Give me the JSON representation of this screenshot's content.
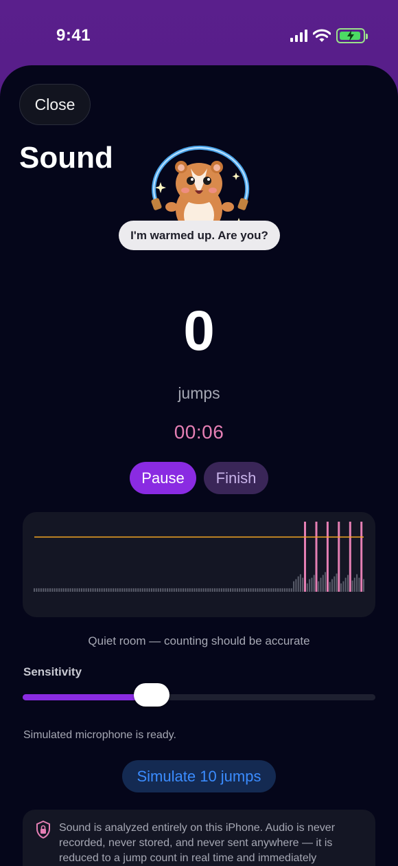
{
  "status_bar": {
    "time": "9:41",
    "icons": [
      "signal-icon",
      "wifi-icon",
      "battery-charging-icon"
    ]
  },
  "header": {
    "close_label": "Close",
    "title": "Sound"
  },
  "mascot": {
    "icon": "hamster-jump-rope-icon",
    "speech": "I'm warmed up. Are you?"
  },
  "counter": {
    "count": "0",
    "unit": "jumps",
    "timer": "00:06"
  },
  "controls": {
    "pause_label": "Pause",
    "finish_label": "Finish"
  },
  "waveform": {
    "threshold_color": "#f5a623",
    "peak_color": "#e57fb4",
    "level_color": "#5a5d6b",
    "levels": [
      0.05,
      0.05,
      0.05,
      0.05,
      0.05,
      0.05,
      0.05,
      0.05,
      0.05,
      0.05,
      0.05,
      0.05,
      0.05,
      0.05,
      0.05,
      0.05,
      0.05,
      0.05,
      0.05,
      0.05,
      0.05,
      0.05,
      0.05,
      0.05,
      0.05,
      0.05,
      0.05,
      0.05,
      0.05,
      0.05,
      0.05,
      0.05,
      0.05,
      0.05,
      0.05,
      0.05,
      0.05,
      0.05,
      0.05,
      0.05,
      0.05,
      0.05,
      0.05,
      0.05,
      0.05,
      0.05,
      0.05,
      0.05,
      0.05,
      0.05,
      0.05,
      0.05,
      0.05,
      0.05,
      0.05,
      0.05,
      0.05,
      0.05,
      0.05,
      0.05,
      0.05,
      0.05,
      0.05,
      0.05,
      0.05,
      0.05,
      0.05,
      0.05,
      0.05,
      0.05,
      0.05,
      0.05,
      0.05,
      0.05,
      0.05,
      0.05,
      0.05,
      0.05,
      0.05,
      0.05,
      0.05,
      0.05,
      0.05,
      0.05,
      0.05,
      0.05,
      0.05,
      0.05,
      0.05,
      0.05,
      0.05,
      0.05,
      0.05,
      0.05,
      0.05,
      0.05,
      0.05,
      0.05,
      0.05,
      0.05,
      0.05,
      0.05,
      0.05,
      0.05,
      0.05,
      0.05,
      0.05,
      0.05,
      0.05,
      0.05,
      0.05,
      0.05,
      0.05,
      0.05,
      0.05,
      0.15,
      0.18,
      0.22,
      0.25,
      0.2,
      1.0,
      0.12,
      0.18,
      0.2,
      0.24,
      1.0,
      0.15,
      0.2,
      0.24,
      0.28,
      1.0,
      0.14,
      0.18,
      0.22,
      0.26,
      1.0,
      0.12,
      0.15,
      0.2,
      0.24,
      1.0,
      0.16,
      0.2,
      0.25,
      0.2,
      1.0,
      0.18
    ],
    "threshold": 0.78
  },
  "room_status": "Quiet room — counting should be accurate",
  "sensitivity": {
    "label": "Sensitivity",
    "value": 0.35
  },
  "mic_status": "Simulated microphone is ready.",
  "simulate_label": "Simulate 10 jumps",
  "privacy": {
    "icon": "lock-shield-icon",
    "text": "Sound is analyzed entirely on this iPhone. Audio is never recorded, never stored, and never sent anywhere — it is reduced to a jump count in real time and immediately"
  }
}
